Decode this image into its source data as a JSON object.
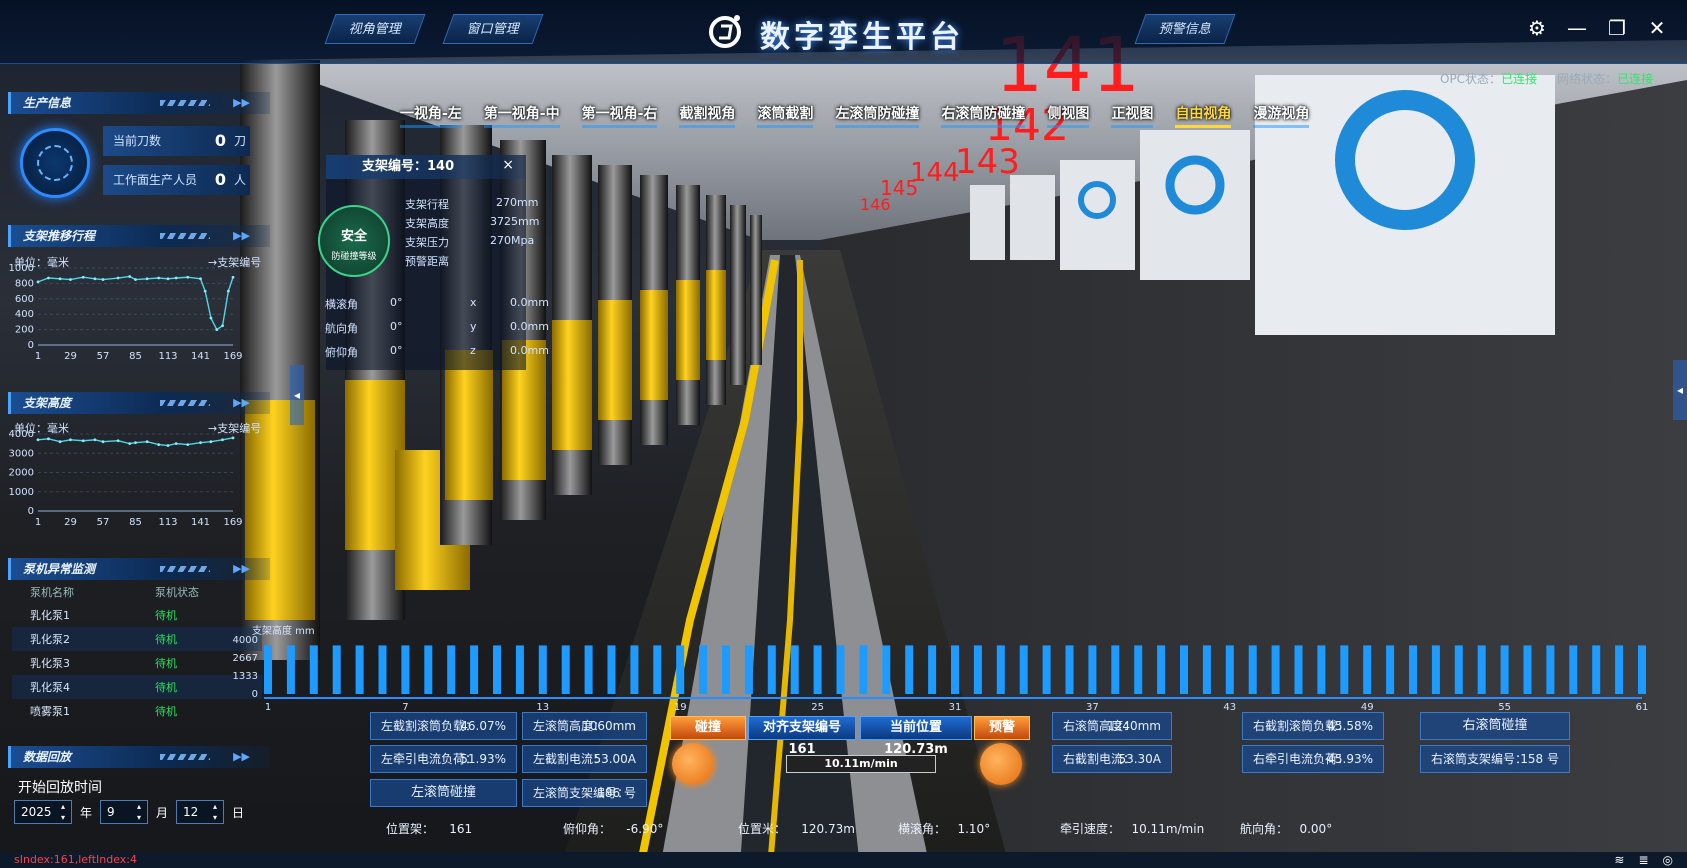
{
  "header": {
    "title": "数字孪生平台",
    "left_buttons": [
      "视角管理",
      "窗口管理"
    ],
    "right_button": "预警信息",
    "opc_label": "OPC状态：",
    "opc_status": "已连接",
    "net_label": "网络状态：",
    "net_status": "已连接",
    "window_controls": [
      "gear-icon",
      "minimize-icon",
      "restore-icon",
      "close-icon"
    ]
  },
  "view_tabs": [
    {
      "label": "一视角-左",
      "active": false
    },
    {
      "label": "第一视角-中",
      "active": false
    },
    {
      "label": "第一视角-右",
      "active": false
    },
    {
      "label": "截割视角",
      "active": false
    },
    {
      "label": "滚筒截割",
      "active": false
    },
    {
      "label": "左滚筒防碰撞",
      "active": false
    },
    {
      "label": "右滚筒防碰撞",
      "active": false
    },
    {
      "label": "侧视图",
      "active": false
    },
    {
      "label": "正视图",
      "active": false
    },
    {
      "label": "自由视角",
      "active": true
    },
    {
      "label": "漫游视角",
      "active": false
    }
  ],
  "support_numbers_3d": [
    "141",
    "142",
    "143",
    "144",
    "145",
    "146"
  ],
  "production": {
    "title": "生产信息",
    "knife_label": "当前刀数",
    "knife_value": "0",
    "knife_unit": "刀",
    "people_label": "工作面生产人员",
    "people_value": "0",
    "people_unit": "人"
  },
  "stroke_panel": {
    "title": "支架推移行程",
    "unit_label": "单位：毫米",
    "series_label": "支架编号"
  },
  "height_panel": {
    "title": "支架高度",
    "unit_label": "单位：毫米",
    "series_label": "支架编号"
  },
  "chart_data": [
    {
      "type": "line",
      "ylim": [
        0,
        1000
      ],
      "yticks": [
        0,
        200,
        400,
        600,
        800,
        1000
      ],
      "xticks": [
        1,
        29,
        57,
        85,
        113,
        141,
        169
      ],
      "x": [
        1,
        10,
        20,
        29,
        40,
        50,
        57,
        70,
        80,
        85,
        95,
        105,
        113,
        120,
        130,
        141,
        145,
        150,
        155,
        160,
        165,
        169
      ],
      "values": [
        820,
        870,
        860,
        850,
        880,
        860,
        850,
        870,
        890,
        850,
        860,
        870,
        860,
        870,
        880,
        860,
        700,
        350,
        200,
        250,
        700,
        880
      ]
    },
    {
      "type": "line",
      "ylim": [
        0,
        4000
      ],
      "yticks": [
        0,
        1000,
        2000,
        3000,
        4000
      ],
      "xticks": [
        1,
        29,
        57,
        85,
        113,
        141,
        169
      ],
      "x": [
        1,
        10,
        20,
        29,
        40,
        50,
        57,
        70,
        80,
        85,
        95,
        105,
        113,
        120,
        130,
        141,
        150,
        160,
        169
      ],
      "values": [
        3700,
        3750,
        3600,
        3700,
        3650,
        3700,
        3600,
        3650,
        3500,
        3550,
        3600,
        3450,
        3400,
        3500,
        3450,
        3550,
        3600,
        3700,
        3800
      ]
    },
    {
      "type": "bar",
      "ylabel": "支架高度  mm",
      "ylim": [
        0,
        4000
      ],
      "yticks": [
        0,
        1333,
        2667,
        4000
      ],
      "xticks": [
        1,
        7,
        13,
        19,
        25,
        31,
        37,
        43,
        49,
        55,
        61
      ],
      "count": 61,
      "values": [
        3600,
        3600,
        3600,
        3600,
        3600,
        3600,
        3600,
        3600,
        3600,
        3600,
        3600,
        3600,
        3600,
        3600,
        3600,
        3600,
        3600,
        3600,
        3600,
        3600,
        3600,
        3600,
        3600,
        3600,
        3600,
        3600,
        3600,
        3600,
        3600,
        3600,
        3600,
        3600,
        3600,
        3600,
        3600,
        3600,
        3600,
        3600,
        3600,
        3600,
        3600,
        3600,
        3600,
        3600,
        3600,
        3600,
        3600,
        3600,
        3600,
        3600,
        3600,
        3600,
        3600,
        3600,
        3600,
        3600,
        3600,
        3600,
        3600,
        3600,
        3600
      ]
    }
  ],
  "pump_panel": {
    "title": "泵机异常监测",
    "col_name": "泵机名称",
    "col_status": "泵机状态",
    "rows": [
      {
        "name": "乳化泵1",
        "status": "待机"
      },
      {
        "name": "乳化泵2",
        "status": "待机"
      },
      {
        "name": "乳化泵3",
        "status": "待机"
      },
      {
        "name": "乳化泵4",
        "status": "待机"
      },
      {
        "name": "喷雾泵1",
        "status": "待机"
      }
    ]
  },
  "replay": {
    "title": "数据回放",
    "start_label": "开始回放时间",
    "year": "2025",
    "year_unit": "年",
    "month": "9",
    "month_unit": "月",
    "day": "12",
    "day_unit": "日"
  },
  "support_popup": {
    "title": "支架编号：140",
    "close": "×",
    "safe_title": "安全",
    "safe_sub": "防碰撞等级",
    "rows": [
      {
        "label": "支架行程",
        "value": "270mm"
      },
      {
        "label": "支架高度",
        "value": "3725mm"
      },
      {
        "label": "支架压力",
        "value": "270Mpa"
      },
      {
        "label": "预警距离",
        "value": ""
      }
    ],
    "angles": [
      {
        "label": "横滚角",
        "value": "0°",
        "axis": "x",
        "mm": "0.0mm"
      },
      {
        "label": "航向角",
        "value": "0°",
        "axis": "y",
        "mm": "0.0mm"
      },
      {
        "label": "俯仰角",
        "value": "0°",
        "axis": "z",
        "mm": "0.0mm"
      }
    ]
  },
  "bottom": {
    "left_load_label": "左截割滚筒负载：",
    "left_load_value": "46.07%",
    "left_height_label": "左滚筒高度：",
    "left_height_value": "1060mm",
    "left_traction_label": "左牵引电流负荷：",
    "left_traction_value": "51.93%",
    "left_cut_current_label": "左截割电流：",
    "left_cut_current_value": "53.00A",
    "left_collision": "左滚筒碰撞",
    "left_support_label": "左滚筒支架编号：",
    "left_support_value": "186 号",
    "btn_collision": "碰撞",
    "btn_align": "对齐支架编号 161",
    "btn_position": "当前位置 120.73m",
    "btn_warning": "预警",
    "speed_box": "10.11m/min",
    "right_height_label": "右滚筒高度：",
    "right_height_value": "1240mm",
    "right_load_label": "右截割滚筒负载：",
    "right_load_value": "45.58%",
    "right_collision": "右滚筒碰撞",
    "right_cut_current_label": "右截割电流：",
    "right_cut_current_value": "53.30A",
    "right_traction_label": "右牵引电流负荷：",
    "right_traction_value": "45.93%",
    "right_support_label": "右滚筒支架编号：",
    "right_support_value": "158 号",
    "pos_support_label": "位置架：",
    "pos_support_value": "161",
    "pitch_label": "俯仰角：",
    "pitch_value": "-6.90°",
    "pos_m_label": "位置米：",
    "pos_m_value": "120.73m",
    "roll_label": "横滚角：",
    "roll_value": "1.10°",
    "traction_speed_label": "牵引速度：",
    "traction_speed_value": "10.11m/min",
    "heading_label": "航向角：",
    "heading_value": "0.00°"
  },
  "footer": {
    "debug": "sIndex:161,leftIndex:4"
  },
  "colors": {
    "accent": "#2a8cff",
    "ok": "#2ee86b",
    "bar": "#1e9bff",
    "warning": "#ff9c3a",
    "active_tab": "#ffd93b"
  }
}
